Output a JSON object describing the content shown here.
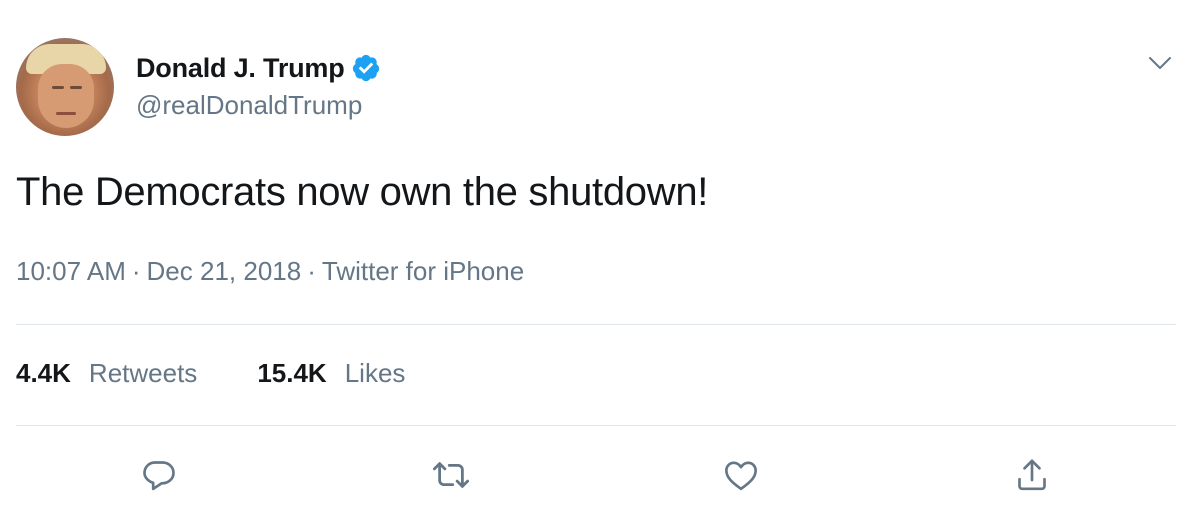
{
  "user": {
    "display_name": "Donald J. Trump",
    "handle": "@realDonaldTrump",
    "verified": true
  },
  "tweet": {
    "text": "The Democrats now own the shutdown!",
    "time": "10:07 AM",
    "date": "Dec 21, 2018",
    "source": "Twitter for iPhone",
    "separator": "·"
  },
  "stats": {
    "retweets_count": "4.4K",
    "retweets_label": "Retweets",
    "likes_count": "15.4K",
    "likes_label": "Likes"
  },
  "icons": {
    "verified": "verified-badge-icon",
    "caret": "chevron-down-icon",
    "reply": "reply-icon",
    "retweet": "retweet-icon",
    "like": "heart-icon",
    "share": "share-icon"
  },
  "colors": {
    "text_primary": "#14171a",
    "text_secondary": "#657786",
    "divider": "#e1e8ed",
    "verified_blue": "#1da1f2"
  }
}
